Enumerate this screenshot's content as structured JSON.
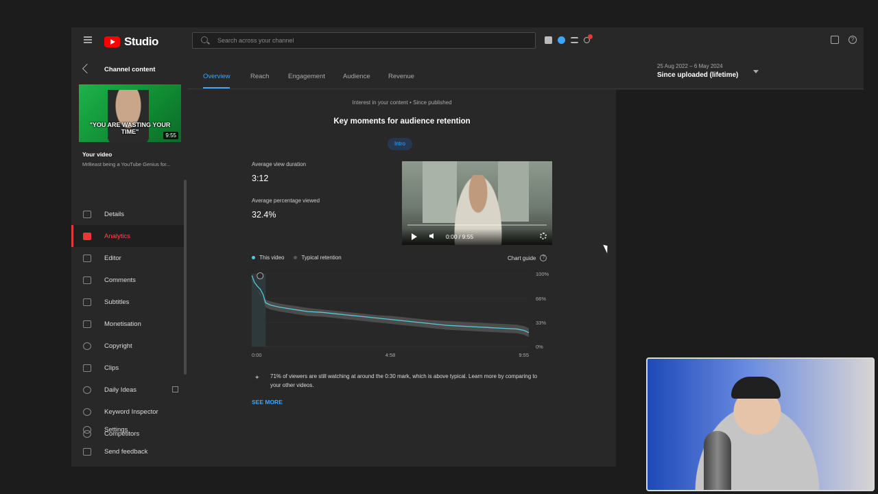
{
  "header": {
    "logo_text": "Studio",
    "search_placeholder": "Search across your channel"
  },
  "sidebar": {
    "back_label": "Channel content",
    "thumbnail_caption": "\"YOU ARE WASTING YOUR TIME\"",
    "thumbnail_duration": "9:55",
    "your_video_label": "Your video",
    "video_title": "MrBeast being a YouTube Genius for...",
    "items": [
      {
        "label": "Details",
        "icon": "pencil-icon"
      },
      {
        "label": "Analytics",
        "icon": "analytics-icon",
        "active": true
      },
      {
        "label": "Editor",
        "icon": "editor-icon"
      },
      {
        "label": "Comments",
        "icon": "comments-icon"
      },
      {
        "label": "Subtitles",
        "icon": "subtitles-icon"
      },
      {
        "label": "Monetisation",
        "icon": "dollar-icon"
      },
      {
        "label": "Copyright",
        "icon": "copyright-icon"
      },
      {
        "label": "Clips",
        "icon": "scissors-icon"
      },
      {
        "label": "Daily Ideas",
        "icon": "extension-icon"
      },
      {
        "label": "Keyword Inspector",
        "icon": "extension-icon"
      },
      {
        "label": "Competitors",
        "icon": "extension-icon"
      }
    ],
    "bottom_items": [
      {
        "label": "Settings",
        "icon": "gear-icon"
      },
      {
        "label": "Send feedback",
        "icon": "feedback-icon"
      }
    ]
  },
  "tabs": [
    "Overview",
    "Reach",
    "Engagement",
    "Audience",
    "Revenue"
  ],
  "date_range": {
    "sub": "25 Aug 2022 – 6 May 2024",
    "main": "Since uploaded (lifetime)"
  },
  "card": {
    "interest": "Interest in your content • Since published",
    "title": "Key moments for audience retention",
    "chip": "Intro",
    "avg_view_duration_label": "Average view duration",
    "avg_view_duration_value": "3:12",
    "avg_pct_label": "Average percentage viewed",
    "avg_pct_value": "32.4%",
    "player_time": "0:00 / 9:55",
    "legend_this": "This video",
    "legend_typical": "Typical retention",
    "chart_guide": "Chart guide",
    "insight": "71% of viewers are still watching at around the 0:30 mark, which is above typical. Learn more by comparing to your other videos.",
    "see_more": "SEE MORE"
  },
  "colors": {
    "accent": "#3ea6ff",
    "active": "#e53935",
    "this_video": "#5bc8d8",
    "typical": "#5a5a5a"
  },
  "chart_data": {
    "type": "area",
    "x_tick_labels": [
      "0:00",
      "4:58",
      "9:55"
    ],
    "y_tick_labels": [
      "100%",
      "66%",
      "33%",
      "0%"
    ],
    "ylim": [
      0,
      100
    ],
    "xlim": [
      0,
      595
    ],
    "series": [
      {
        "name": "This video",
        "x": [
          0,
          6,
          12,
          18,
          24,
          30,
          40,
          60,
          90,
          120,
          150,
          180,
          210,
          240,
          270,
          300,
          330,
          360,
          390,
          420,
          450,
          480,
          510,
          540,
          570,
          585,
          595
        ],
        "values": [
          98,
          88,
          83,
          79,
          72,
          60,
          57,
          54,
          51,
          48,
          47,
          45,
          43,
          41,
          39,
          37,
          35,
          33,
          31,
          29,
          28,
          27,
          26,
          25,
          24,
          22,
          19
        ]
      },
      {
        "name": "Typical retention",
        "x": [
          0,
          6,
          12,
          18,
          24,
          30,
          40,
          60,
          90,
          120,
          150,
          180,
          210,
          240,
          270,
          300,
          330,
          360,
          390,
          420,
          450,
          480,
          510,
          540,
          570,
          585,
          595
        ],
        "values": [
          95,
          82,
          77,
          71,
          66,
          64,
          62,
          59,
          56,
          53,
          51,
          49,
          47,
          45,
          43,
          42,
          40,
          38,
          36,
          35,
          34,
          33,
          32,
          31,
          30,
          28,
          25
        ]
      }
    ],
    "highlight_range": [
      0,
      30
    ],
    "grid": true,
    "legend": "top-left"
  }
}
